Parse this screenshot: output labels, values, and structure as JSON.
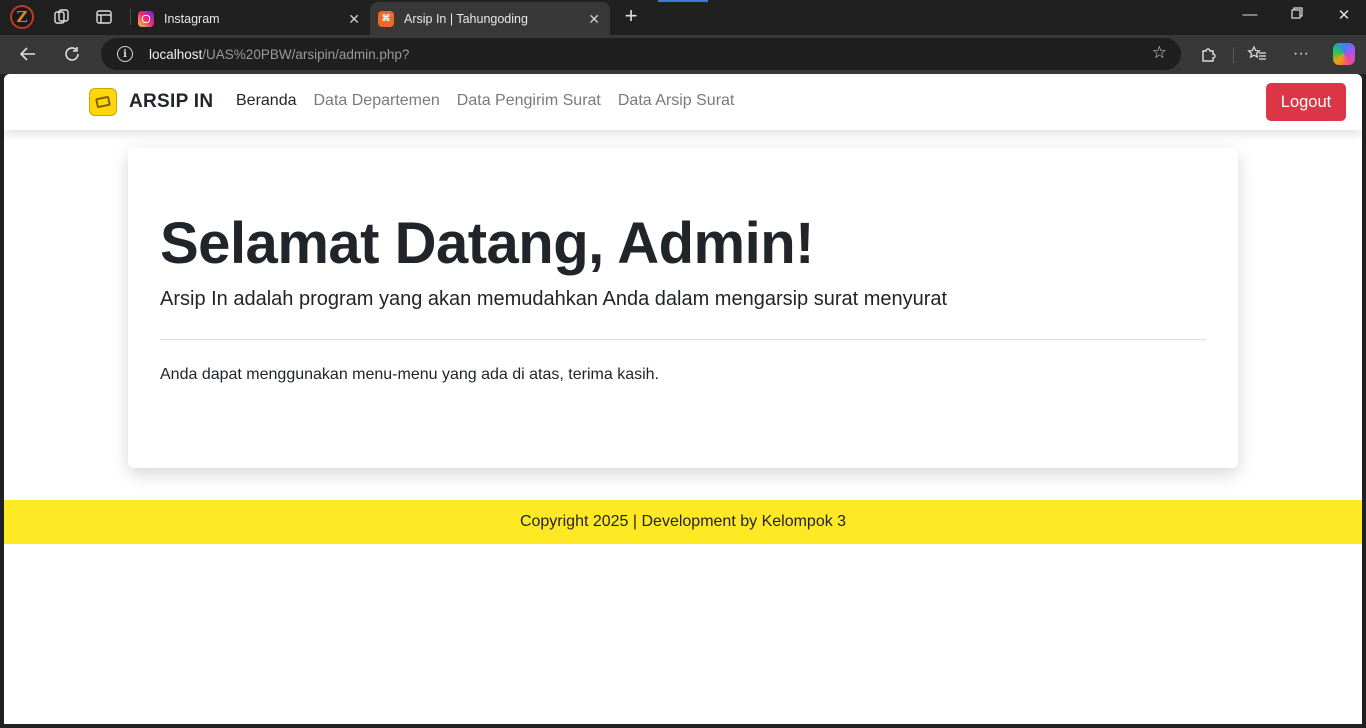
{
  "browser": {
    "tabs": [
      {
        "title": "Instagram",
        "active": false
      },
      {
        "title": "Arsip In | Tahungoding",
        "active": true
      }
    ],
    "url_host": "localhost",
    "url_path": "/UAS%20PBW/arsipin/admin.php?",
    "profile_letter": "Z",
    "favicon_letters": "x",
    "icons": {
      "back": "arrow-left-icon",
      "reload": "reload-icon",
      "info": "info-icon",
      "favorite": "star-icon",
      "extensions": "puzzle-icon",
      "favorites": "favorites-list-icon",
      "more": "ellipsis-icon",
      "copilot": "copilot-icon"
    }
  },
  "navbar": {
    "brand": "ARSIP IN",
    "menu": [
      {
        "label": "Beranda",
        "active": true
      },
      {
        "label": "Data Departemen",
        "active": false
      },
      {
        "label": "Data Pengirim Surat",
        "active": false
      },
      {
        "label": "Data Arsip Surat",
        "active": false
      }
    ],
    "logout_label": "Logout"
  },
  "hero": {
    "title": "Selamat Datang, Admin!",
    "lead": "Arsip In adalah program yang akan memudahkan Anda dalam mengarsip surat menyurat",
    "text": "Anda dapat menggunakan menu-menu yang ada di atas, terima kasih."
  },
  "footer": {
    "text": "Copyright 2025 | Development by Kelompok 3"
  },
  "colors": {
    "footer_bg": "#ffe924",
    "logout_bg": "#dc3545",
    "brand_logo": "#ffd60a"
  }
}
